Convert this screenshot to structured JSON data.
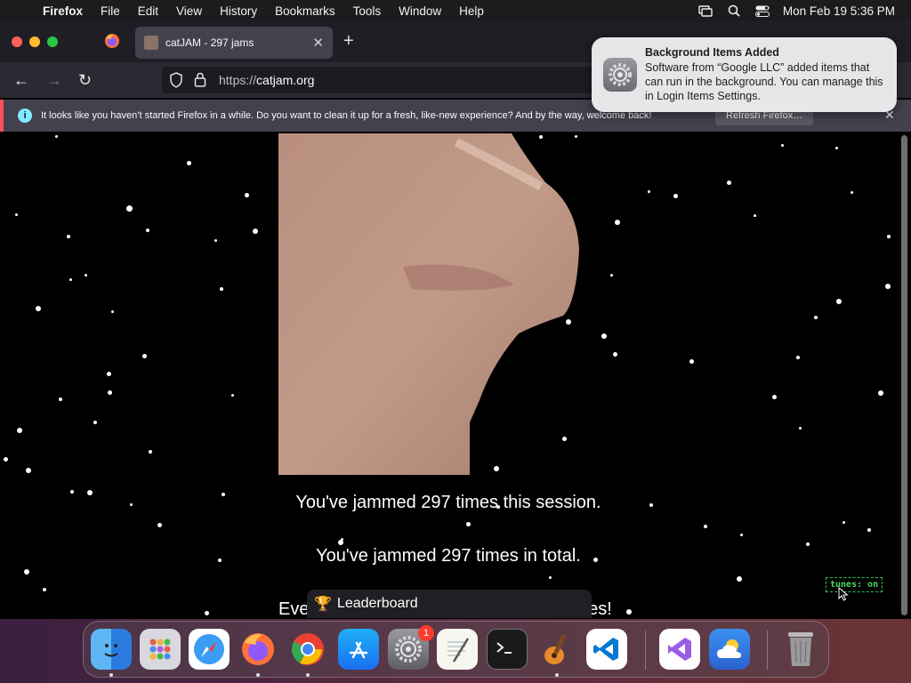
{
  "menubar": {
    "app": "Firefox",
    "items": [
      "File",
      "Edit",
      "View",
      "History",
      "Bookmarks",
      "Tools",
      "Window",
      "Help"
    ],
    "datetime": "Mon Feb 19  5:36 PM"
  },
  "tabs": {
    "active_title": "catJAM - 297 jams"
  },
  "urlbar": {
    "scheme": "https://",
    "host": "catjam.org"
  },
  "infobar": {
    "message": "It looks like you haven’t started Firefox in a while. Do you want to clean it up for a fresh, like-new experience? And by the way, welcome back!",
    "button": "Refresh Firefox…"
  },
  "notification": {
    "title": "Background Items Added",
    "body": "Software from “Google LLC” added items that can run in the background. You can manage this in Login Items Settings."
  },
  "page": {
    "session_text": "You've jammed 297 times this session.",
    "total_text": "You've jammed 297 times in total.",
    "partial_start": "Eve",
    "partial_end": "nes!",
    "leaderboard": "Leaderboard",
    "tunes": "tunes: on"
  },
  "dock": {
    "items": [
      "Finder",
      "Launchpad",
      "Safari",
      "Firefox",
      "Chrome",
      "App Store",
      "System Settings",
      "TextEdit",
      "Terminal",
      "GarageBand",
      "Visual Studio Code",
      "Visual Studio",
      "Weather",
      "Trash"
    ],
    "system_settings_badge": "1"
  },
  "colors": {
    "accent_red": "#ff4f5e",
    "tunes_green": "#4cd964",
    "menubar_bg": "#1c1c1e"
  }
}
